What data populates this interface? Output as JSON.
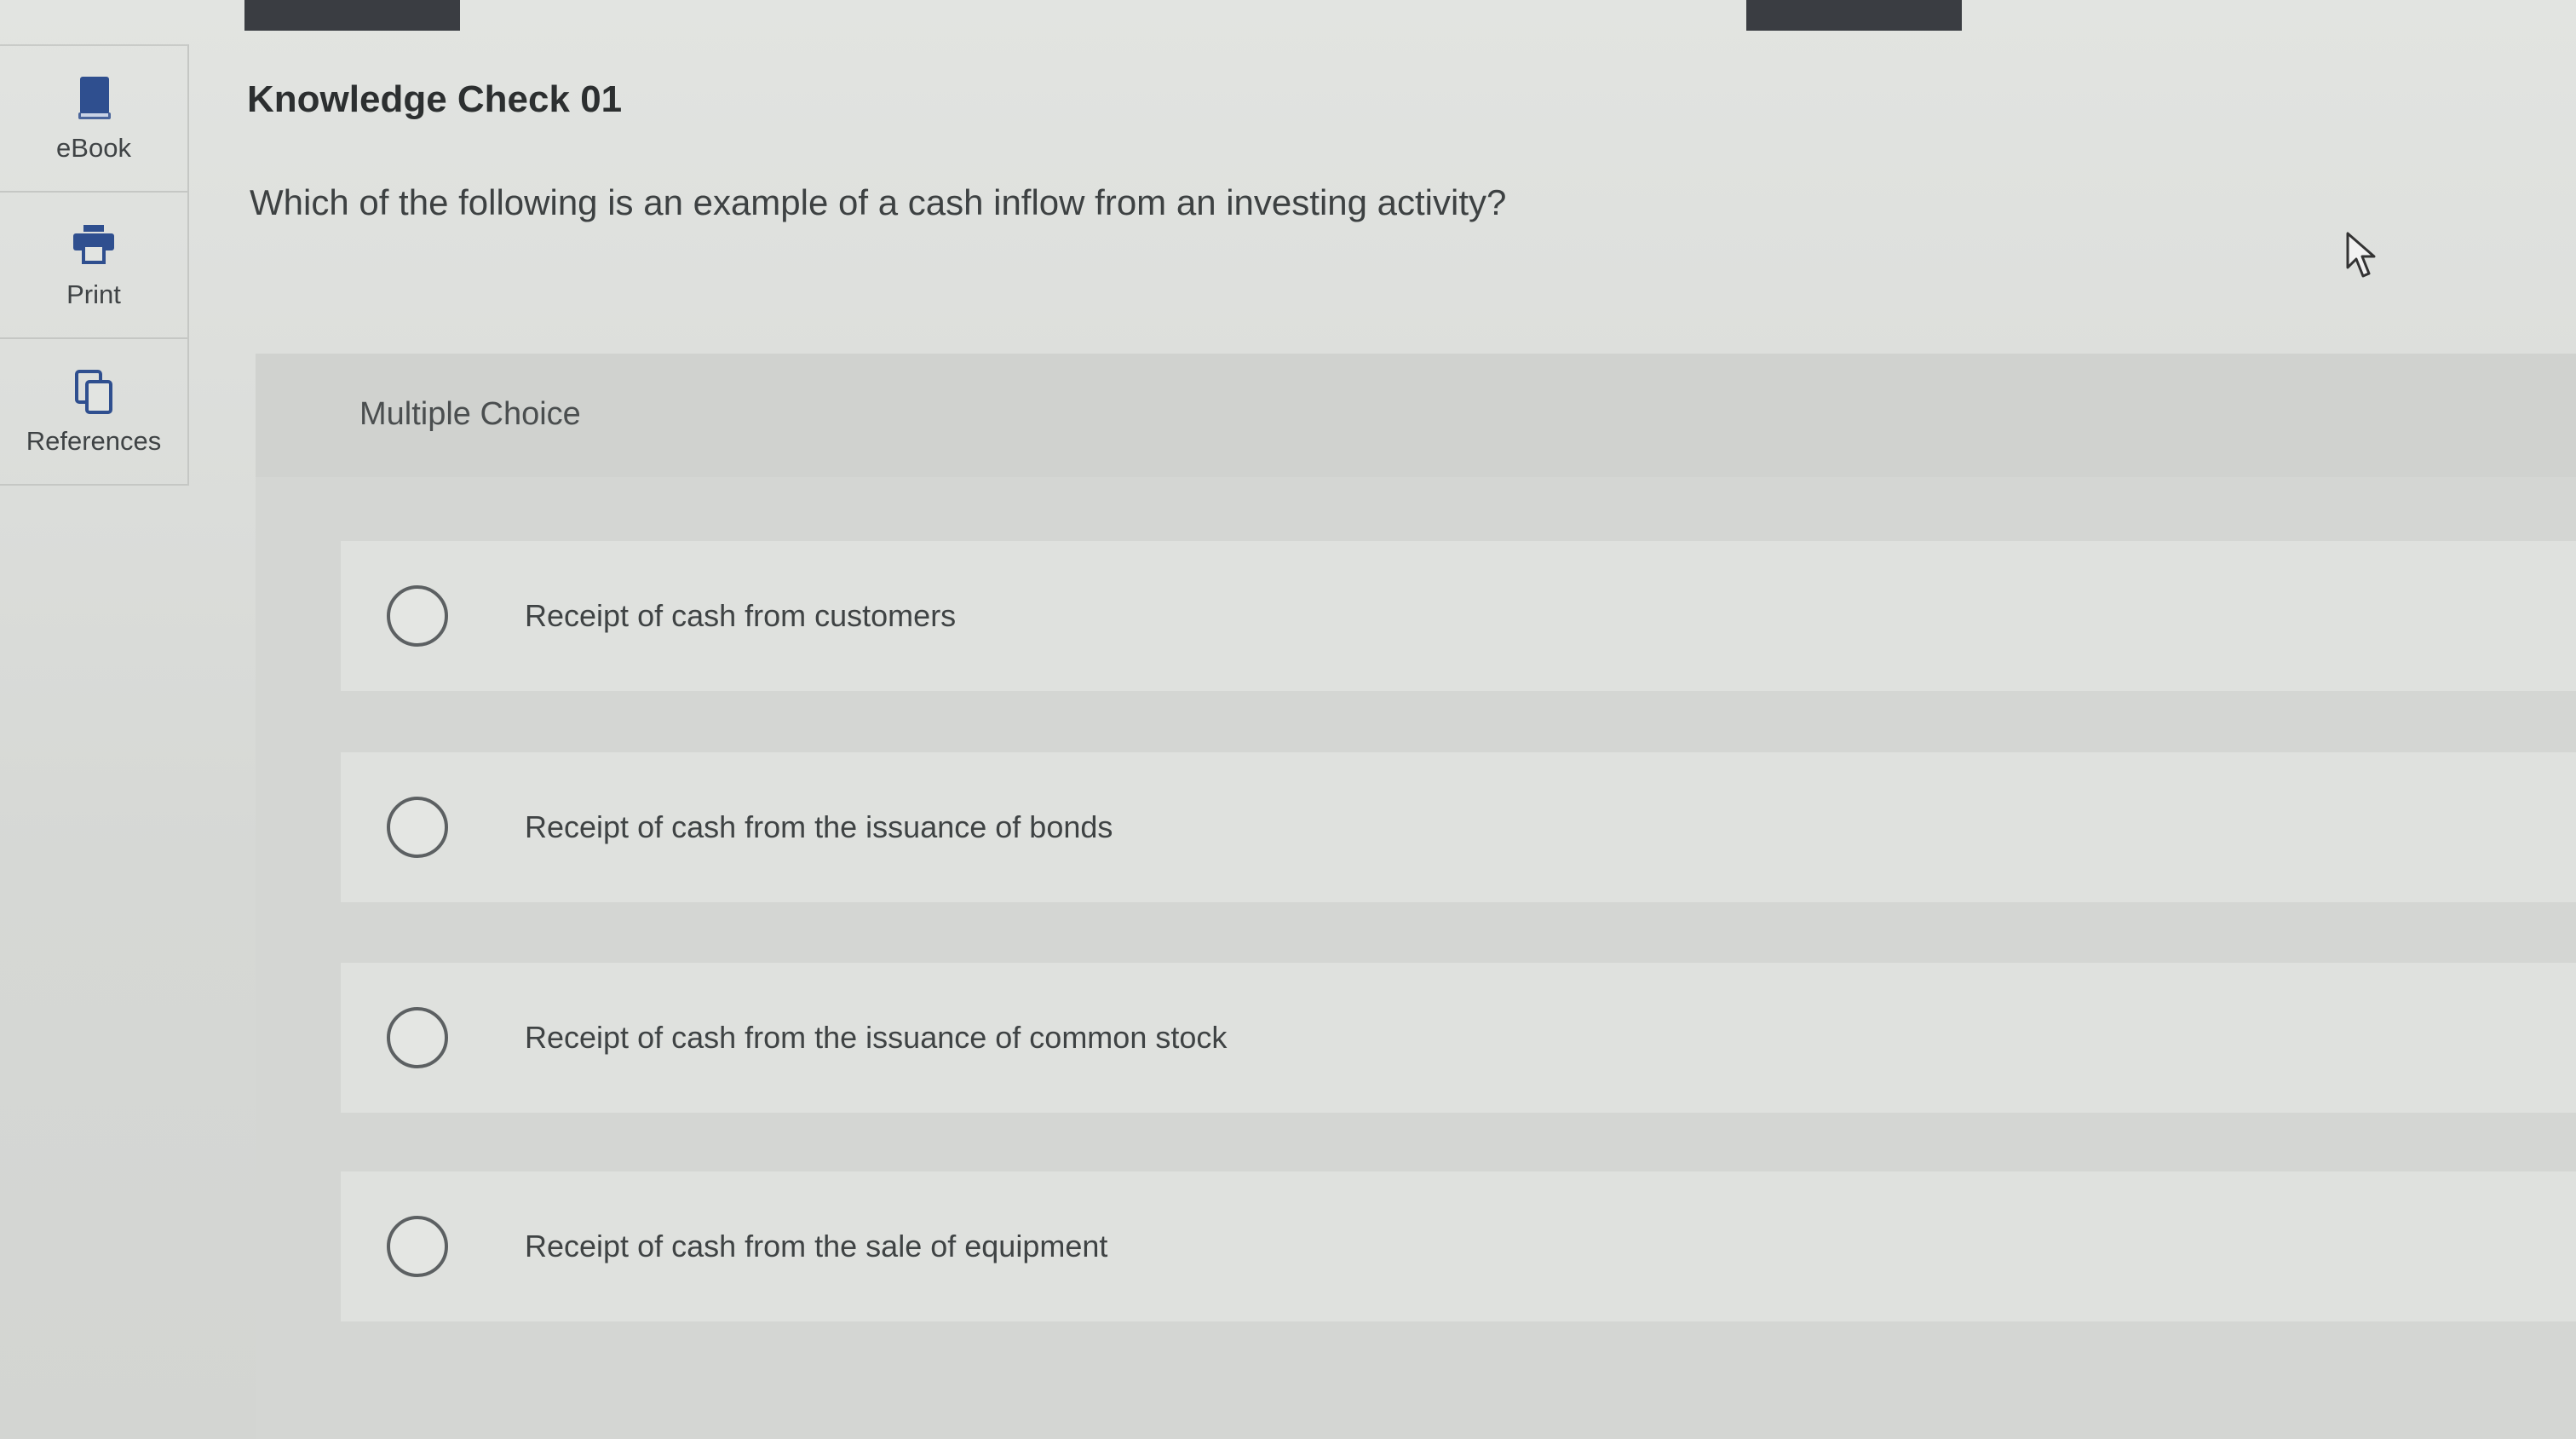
{
  "sidebar": {
    "items": [
      {
        "label": "eBook",
        "icon": "book-icon"
      },
      {
        "label": "Print",
        "icon": "printer-icon"
      },
      {
        "label": "References",
        "icon": "copy-icon"
      }
    ]
  },
  "header": {
    "title": "Knowledge Check 01"
  },
  "question": {
    "text": "Which of the following is an example of a cash inflow from an investing activity?",
    "type_label": "Multiple Choice",
    "options": [
      {
        "label": "Receipt of cash from customers",
        "selected": false
      },
      {
        "label": "Receipt of cash from the issuance of bonds",
        "selected": false
      },
      {
        "label": "Receipt of cash from the issuance of common stock",
        "selected": false
      },
      {
        "label": "Receipt of cash from the sale of equipment",
        "selected": false
      }
    ]
  },
  "colors": {
    "accent_icon": "#2f4f8f",
    "top_bar": "#3a3d42"
  }
}
